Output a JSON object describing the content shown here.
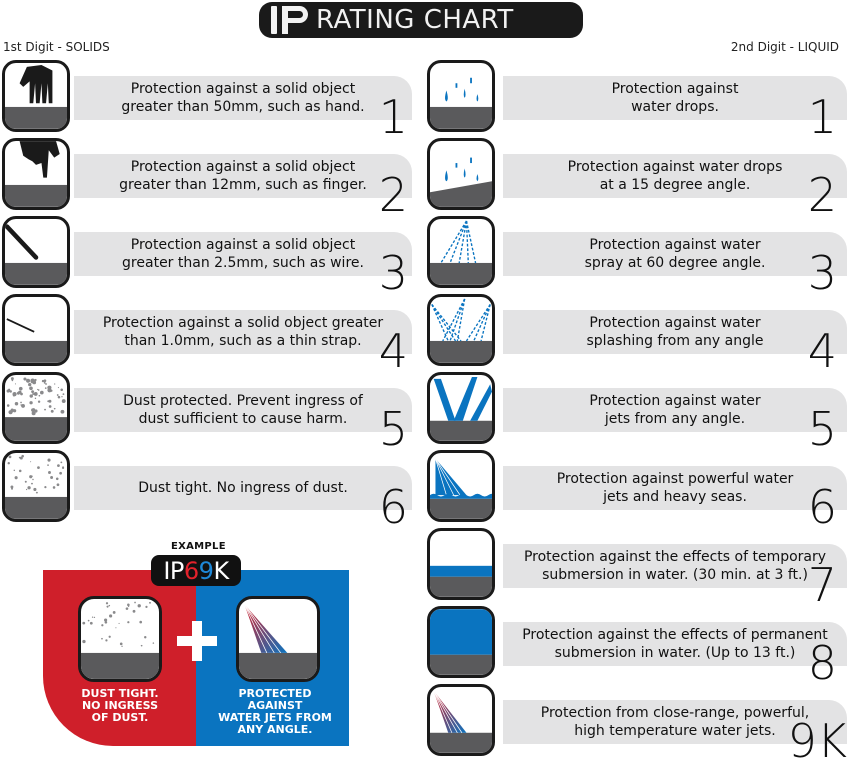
{
  "header": {
    "title_logo": "IP",
    "title": "RATING CHART",
    "left_column_heading": "1st Digit - SOLIDS",
    "right_column_heading": "2nd Digit - LIQUID"
  },
  "colors": {
    "title_bg": "#1a1a1a",
    "band_gray": "#e3e3e4",
    "ground_gray": "#5a5a5c",
    "water_blue": "#0a74c0",
    "example_red": "#cf1f2a",
    "example_blue": "#0a74c0"
  },
  "solids": [
    {
      "digit": "1",
      "icon": "hand-icon",
      "description": "Protection against a solid object\ngreater than 50mm, such as hand."
    },
    {
      "digit": "2",
      "icon": "finger-icon",
      "description": "Protection against a solid object\ngreater than 12mm, such as finger."
    },
    {
      "digit": "3",
      "icon": "wire-icon",
      "description": "Protection against a solid object\ngreater than 2.5mm, such as wire."
    },
    {
      "digit": "4",
      "icon": "thin-strap-icon",
      "description": "Protection against a solid object greater\nthan 1.0mm, such as a thin strap."
    },
    {
      "digit": "5",
      "icon": "dust-protected-icon",
      "description": "Dust protected. Prevent ingress of\ndust sufficient to cause harm."
    },
    {
      "digit": "6",
      "icon": "dust-tight-icon",
      "description": "Dust tight. No ingress of dust."
    }
  ],
  "liquids": [
    {
      "digit": "1",
      "icon": "water-drops-icon",
      "description": "Protection against\nwater drops."
    },
    {
      "digit": "2",
      "icon": "angled-water-drops-icon",
      "description": "Protection against water drops\nat a 15 degree angle."
    },
    {
      "digit": "3",
      "icon": "water-spray-icon",
      "description": "Protection against water\nspray at 60 degree angle."
    },
    {
      "digit": "4",
      "icon": "water-splash-icon",
      "description": "Protection against water\nsplashing from any angle"
    },
    {
      "digit": "5",
      "icon": "water-jets-icon",
      "description": "Protection against water\njets from any angle."
    },
    {
      "digit": "6",
      "icon": "powerful-jets-icon",
      "description": "Protection against powerful water\njets and heavy seas."
    },
    {
      "digit": "7",
      "icon": "temporary-submersion-icon",
      "description": "Protection against the effects of temporary\nsubmersion in water. (30 min. at 3 ft.)"
    },
    {
      "digit": "8",
      "icon": "permanent-submersion-icon",
      "description": "Protection against the effects of permanent\nsubmersion in water. (Up to 13 ft.)"
    },
    {
      "digit": "9K",
      "icon": "high-temp-jets-icon",
      "description": "Protection from close-range, powerful,\nhigh temperature water jets."
    }
  ],
  "example": {
    "label": "EXAMPLE",
    "code_prefix": "IP",
    "code_first_digit": "6",
    "code_second_digit": "9",
    "code_suffix": "K",
    "left_caption": "DUST TIGHT.\nNO INGRESS\nOF DUST.",
    "right_caption": "PROTECTED AGAINST\nWATER JETS FROM\nANY ANGLE."
  }
}
